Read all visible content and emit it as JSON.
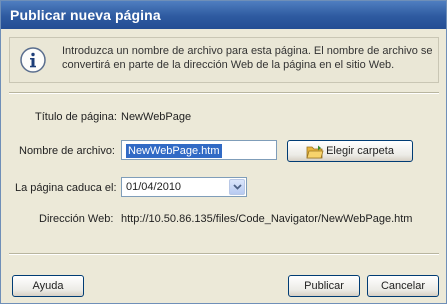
{
  "dialog": {
    "title": "Publicar nueva página",
    "info_text": "Introduzca un nombre de archivo para esta página. El nombre de archivo se convertirá en parte de la dirección Web de la página en el sitio Web."
  },
  "form": {
    "page_title_label": "Título de página:",
    "page_title_value": "NewWebPage",
    "filename_label": "Nombre de archivo:",
    "filename_value": "NewWebPage.htm",
    "choose_folder_label": "Elegir carpeta",
    "expires_label": "La página caduca el:",
    "expires_value": "01/04/2010",
    "web_address_label": "Dirección Web:",
    "web_address_value": "http://10.50.86.135/files/Code_Navigator/NewWebPage.htm"
  },
  "footer": {
    "help_label": "Ayuda",
    "publish_label": "Publicar",
    "cancel_label": "Cancelar"
  },
  "colors": {
    "titlebar": "#2e5aa0",
    "dialog_bg": "#ece9d8",
    "selection": "#316ac5"
  }
}
